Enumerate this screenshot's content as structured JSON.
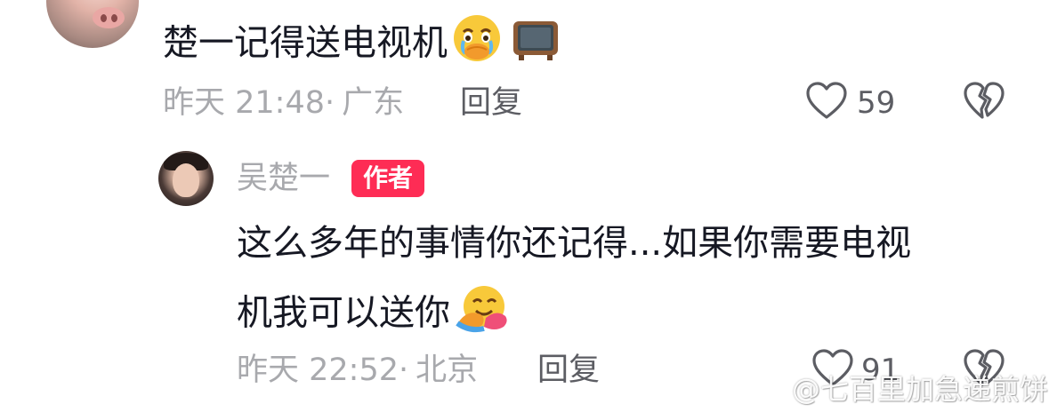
{
  "comment": {
    "text": "楚一记得送电视机",
    "emojis": [
      "face-holding-back-tears-icon",
      "television-icon"
    ],
    "time": "昨天 21:48",
    "separator": "·",
    "location": "广东",
    "reply_label": "回复",
    "likes": "59"
  },
  "reply": {
    "username": "吴楚一",
    "badge": "作者",
    "text_line1": "这么多年的事情你还记得...如果你需要电视",
    "text_line2": "机我可以送你",
    "emojis": [
      "hugging-face-icon"
    ],
    "time": "昨天 22:52",
    "separator": "·",
    "location": "北京",
    "reply_label": "回复",
    "likes": "91"
  },
  "watermark": {
    "text": "@七百里加急递煎饼"
  },
  "colors": {
    "badge": "#fe2c55",
    "meta": "#a8a9ad",
    "text": "#161823",
    "action": "#5c5d63"
  }
}
